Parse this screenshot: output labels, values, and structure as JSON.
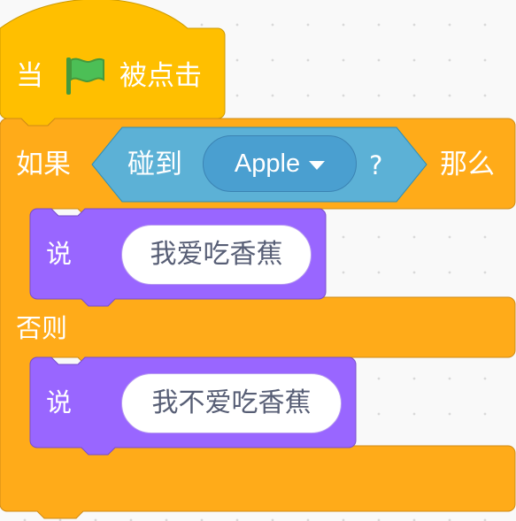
{
  "hat_block": {
    "prefix_label": "当",
    "flag_icon": "green-flag-icon",
    "suffix_label": "被点击"
  },
  "if_else_block": {
    "if_label": "如果",
    "then_label": "那么",
    "else_label": "否则",
    "condition": {
      "label": "碰到",
      "target": "Apple",
      "question_mark": "?"
    },
    "then_branch": {
      "say_label": "说",
      "message": "我爱吃香蕉"
    },
    "else_branch": {
      "say_label": "说",
      "message": "我不爱吃香蕉"
    }
  },
  "colors": {
    "events": "#ffbf00",
    "control": "#ffab19",
    "sensing": "#5cb1d6",
    "looks": "#9966ff",
    "flag": "#4cbf56"
  }
}
